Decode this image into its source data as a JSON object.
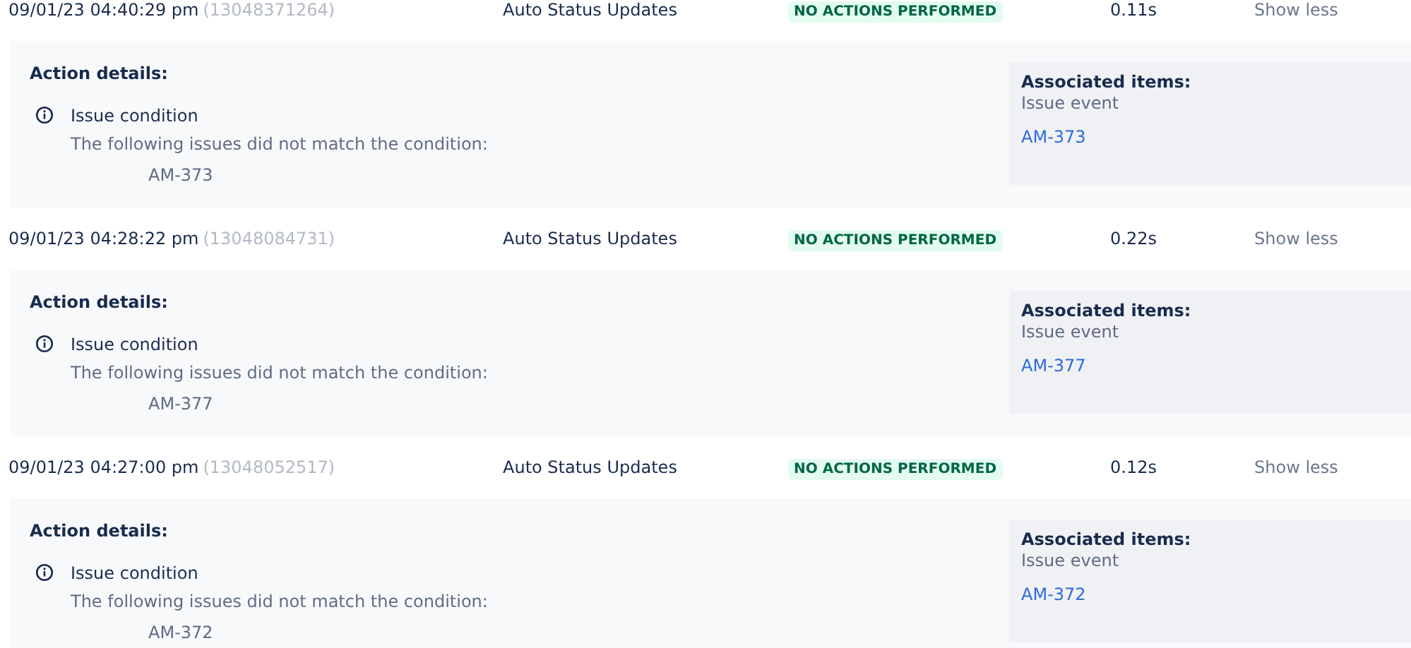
{
  "entries": [
    {
      "timestamp": "09/01/23 04:40:29 pm",
      "id": "(13048371264)",
      "rule": "Auto Status Updates",
      "status": "NO ACTIONS PERFORMED",
      "duration": "0.11s",
      "toggle": "Show less",
      "details": {
        "heading": "Action details:",
        "condition": "Issue condition",
        "message": "The following issues did not match the condition:",
        "issues": [
          "AM-373"
        ]
      },
      "associated": {
        "heading": "Associated items:",
        "type": "Issue event",
        "links": [
          "AM-373"
        ]
      }
    },
    {
      "timestamp": "09/01/23 04:28:22 pm",
      "id": "(13048084731)",
      "rule": "Auto Status Updates",
      "status": "NO ACTIONS PERFORMED",
      "duration": "0.22s",
      "toggle": "Show less",
      "details": {
        "heading": "Action details:",
        "condition": "Issue condition",
        "message": "The following issues did not match the condition:",
        "issues": [
          "AM-377"
        ]
      },
      "associated": {
        "heading": "Associated items:",
        "type": "Issue event",
        "links": [
          "AM-377"
        ]
      }
    },
    {
      "timestamp": "09/01/23 04:27:00 pm",
      "id": "(13048052517)",
      "rule": "Auto Status Updates",
      "status": "NO ACTIONS PERFORMED",
      "duration": "0.12s",
      "toggle": "Show less",
      "details": {
        "heading": "Action details:",
        "condition": "Issue condition",
        "message": "The following issues did not match the condition:",
        "issues": [
          "AM-372"
        ]
      },
      "associated": {
        "heading": "Associated items:",
        "type": "Issue event",
        "links": [
          "AM-372"
        ]
      }
    }
  ]
}
